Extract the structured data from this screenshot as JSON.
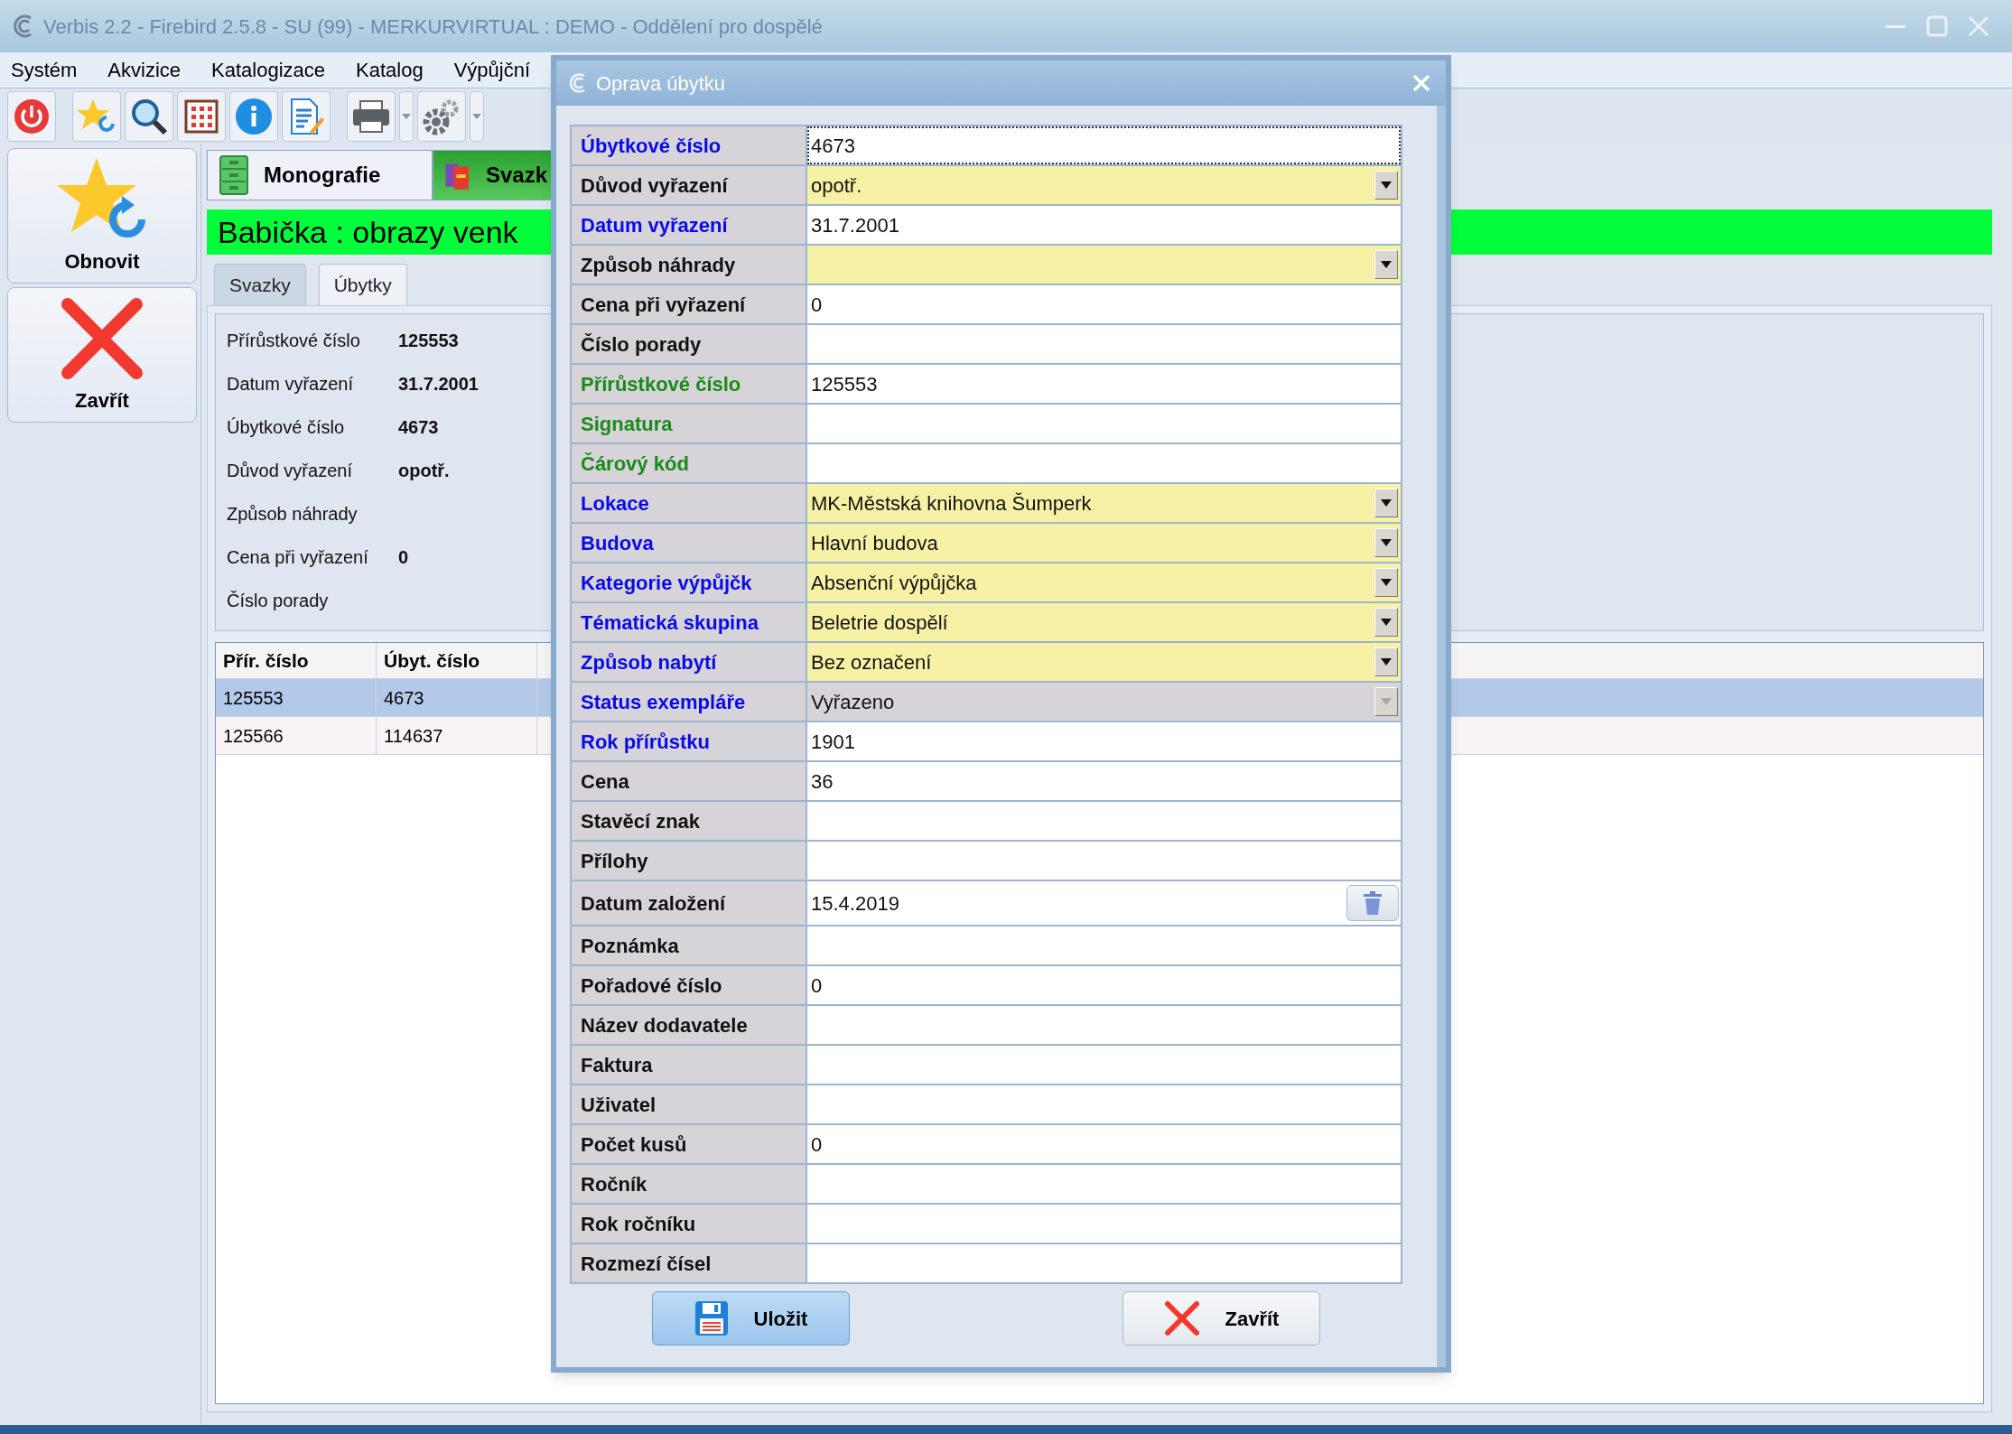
{
  "window": {
    "title": "Verbis 2.2 - Firebird 2.5.8 - SU (99) - MERKURVIRTUAL : DEMO - Oddělení pro dospělé"
  },
  "menu": [
    "Systém",
    "Akvizice",
    "Katalogizace",
    "Katalog",
    "Výpůjční"
  ],
  "side_buttons": [
    {
      "label": "Obnovit",
      "kind": "refresh"
    },
    {
      "label": "Zavřít",
      "kind": "close"
    }
  ],
  "module_tabs": [
    {
      "label": "Monografie",
      "kind": "cabinet",
      "selected": false
    },
    {
      "label": "Svazk",
      "kind": "books",
      "selected": true
    }
  ],
  "record_title": "Babička : obrazy venk",
  "sub_tabs": [
    {
      "label": "Svazky",
      "selected": false
    },
    {
      "label": "Úbytky",
      "selected": true
    }
  ],
  "details": [
    {
      "label": "Přírůstkové číslo",
      "value": "125553"
    },
    {
      "label": "Datum vyřazení",
      "value": "31.7.2001"
    },
    {
      "label": "Úbytkové číslo",
      "value": "4673"
    },
    {
      "label": "Důvod vyřazení",
      "value": "opotř."
    },
    {
      "label": "Způsob náhrady"
    },
    {
      "label": "Cena při vyřazení",
      "value": "0"
    },
    {
      "label": "Číslo porady"
    }
  ],
  "table": {
    "columns": [
      "Přír. číslo",
      "Úbyt. číslo"
    ],
    "rows": [
      {
        "cells": [
          "125553",
          "4673"
        ],
        "selected": true
      },
      {
        "cells": [
          "125566",
          "114637"
        ],
        "selected": false
      }
    ]
  },
  "dialog": {
    "title": "Oprava úbytku",
    "fields": [
      {
        "label": "Úbytkové číslo",
        "color": "#0a0ae6",
        "kind": "text",
        "value": "4673",
        "focused": true,
        "disabled": false
      },
      {
        "label": "Důvod vyřazení",
        "color": "#111111",
        "kind": "select",
        "value": "opotř.",
        "focused": false,
        "disabled": false
      },
      {
        "label": "Datum vyřazení",
        "color": "#0a0ae6",
        "kind": "text",
        "value": "31.7.2001",
        "focused": false,
        "disabled": false
      },
      {
        "label": "Způsob náhrady",
        "color": "#111111",
        "kind": "select",
        "focused": false,
        "disabled": false
      },
      {
        "label": "Cena při vyřazení",
        "color": "#111111",
        "kind": "text",
        "value": "0",
        "focused": false,
        "disabled": false
      },
      {
        "label": "Číslo porady",
        "color": "#111111",
        "kind": "text",
        "focused": false,
        "disabled": false
      },
      {
        "label": "Přírůstkové číslo",
        "color": "#1a8a1a",
        "kind": "text",
        "value": "125553",
        "focused": false,
        "disabled": false
      },
      {
        "label": "Signatura",
        "color": "#1a8a1a",
        "kind": "text",
        "focused": false,
        "disabled": false
      },
      {
        "label": "Čárový kód",
        "color": "#1a8a1a",
        "kind": "text",
        "focused": false,
        "disabled": false
      },
      {
        "label": "Lokace",
        "color": "#0a0ae6",
        "kind": "select",
        "value": "MK-Městská knihovna Šumperk",
        "focused": false,
        "disabled": false
      },
      {
        "label": "Budova",
        "color": "#0a0ae6",
        "kind": "select",
        "value": "Hlavní budova",
        "focused": false,
        "disabled": false
      },
      {
        "label": "Kategorie výpůjčk",
        "color": "#0a0ae6",
        "kind": "select",
        "value": "Absenční výpůjčka",
        "focused": false,
        "disabled": false
      },
      {
        "label": "Tématická skupina",
        "color": "#0a0ae6",
        "kind": "select",
        "value": "Beletrie dospělí",
        "focused": false,
        "disabled": false
      },
      {
        "label": "Způsob nabytí",
        "color": "#0a0ae6",
        "kind": "select",
        "value": "Bez označení",
        "focused": false,
        "disabled": false
      },
      {
        "label": "Status exempláře",
        "color": "#0a0ae6",
        "kind": "select",
        "value": "Vyřazeno",
        "focused": false,
        "disabled": true
      },
      {
        "label": "Rok přírůstku",
        "color": "#0a0ae6",
        "kind": "text",
        "value": "1901",
        "focused": false,
        "disabled": false
      },
      {
        "label": "Cena",
        "color": "#111111",
        "kind": "text",
        "value": "36",
        "focused": false,
        "disabled": false
      },
      {
        "label": "Stavěcí znak",
        "color": "#111111",
        "kind": "text",
        "focused": false,
        "disabled": false
      },
      {
        "label": "Přílohy",
        "color": "#111111",
        "kind": "text",
        "focused": false,
        "disabled": false
      },
      {
        "label": "Datum založení",
        "color": "#111111",
        "kind": "date",
        "value": "15.4.2019",
        "focused": false,
        "disabled": false
      },
      {
        "label": "Poznámka",
        "color": "#111111",
        "kind": "text",
        "focused": false,
        "disabled": false
      },
      {
        "label": "Pořadové číslo",
        "color": "#111111",
        "kind": "text",
        "value": "0",
        "focused": false,
        "disabled": false
      },
      {
        "label": "Název dodavatele",
        "color": "#111111",
        "kind": "text",
        "focused": false,
        "disabled": false
      },
      {
        "label": "Faktura",
        "color": "#111111",
        "kind": "text",
        "focused": false,
        "disabled": false
      },
      {
        "label": "Uživatel",
        "color": "#111111",
        "kind": "text",
        "focused": false,
        "disabled": false
      },
      {
        "label": "Počet kusů",
        "color": "#111111",
        "kind": "text",
        "value": "0",
        "focused": false,
        "disabled": false
      },
      {
        "label": "Ročník",
        "color": "#111111",
        "kind": "text",
        "focused": false,
        "disabled": false
      },
      {
        "label": "Rok ročníku",
        "color": "#111111",
        "kind": "text",
        "focused": false,
        "disabled": false
      },
      {
        "label": "Rozmezí čísel",
        "color": "#111111",
        "kind": "text",
        "focused": false,
        "disabled": false
      }
    ],
    "buttons": [
      {
        "label": "Uložit",
        "kind": "save",
        "default": true
      },
      {
        "label": "Zavřít",
        "kind": "close",
        "default": false
      }
    ]
  }
}
